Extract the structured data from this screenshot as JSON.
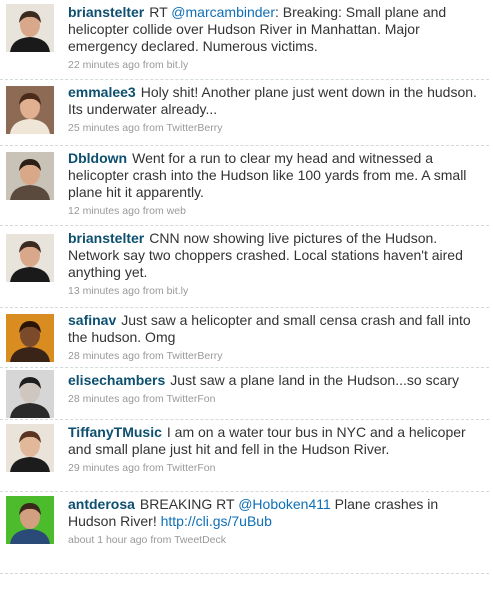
{
  "tweets": [
    {
      "user": "brianstelter",
      "parts": [
        {
          "type": "text",
          "text": "RT "
        },
        {
          "type": "mention",
          "text": "@marcambinder"
        },
        {
          "type": "text",
          "text": ": Breaking: Small plane and helicopter collide over Hudson River in Manhattan. Major emergency declared. Numerous victims."
        }
      ],
      "time": "22 minutes ago",
      "from": "from",
      "source": "bit.ly",
      "avatar": {
        "bg": "#e8e4dc",
        "skin": "#d9a88a",
        "hair": "#3b2a20",
        "shirt": "#1a1a1a"
      }
    },
    {
      "user": "emmalee3",
      "parts": [
        {
          "type": "text",
          "text": "Holy shit! Another plane just went down in the hudson. Its underwater already..."
        }
      ],
      "time": "25 minutes ago",
      "from": "from",
      "source": "TwitterBerry",
      "avatar": {
        "bg": "#8c6a54",
        "skin": "#e0b090",
        "hair": "#4a2a18",
        "shirt": "#f0e6d8"
      }
    },
    {
      "user": "Dbldown",
      "parts": [
        {
          "type": "text",
          "text": "Went for a run to clear my head and witnessed a helicopter crash into the Hudson like 100 yards from me. A small plane hit it apparently."
        }
      ],
      "time": "12 minutes ago",
      "from": "from",
      "source": "web",
      "avatar": {
        "bg": "#c9c2b6",
        "skin": "#d8a888",
        "hair": "#2a1e16",
        "shirt": "#5a4a3e"
      }
    },
    {
      "user": "brianstelter",
      "parts": [
        {
          "type": "text",
          "text": "CNN now showing live pictures of the Hudson. Network say two choppers crashed. Local stations haven't aired anything yet."
        }
      ],
      "time": "13 minutes ago",
      "from": "from",
      "source": "bit.ly",
      "avatar": {
        "bg": "#e8e4dc",
        "skin": "#d9a88a",
        "hair": "#3b2a20",
        "shirt": "#1a1a1a"
      }
    },
    {
      "user": "safinav",
      "parts": [
        {
          "type": "text",
          "text": "Just saw a helicopter and small censa crash and fall into the hudson. Omg"
        }
      ],
      "time": "28 minutes ago",
      "from": "from",
      "source": "TwitterBerry",
      "avatar": {
        "bg": "#d98c20",
        "skin": "#7a4a2a",
        "hair": "#2a1408",
        "shirt": "#3a2418"
      }
    },
    {
      "user": "elisechambers",
      "parts": [
        {
          "type": "text",
          "text": "Just saw a plane land in the Hudson...so scary"
        }
      ],
      "time": "28 minutes ago",
      "from": "from",
      "source": "TwitterFon",
      "avatar": {
        "bg": "#d6d6d6",
        "skin": "#cfc6bf",
        "hair": "#1e1e1e",
        "shirt": "#2a2a2a"
      }
    },
    {
      "user": "TiffanyTMusic",
      "parts": [
        {
          "type": "text",
          "text": "I am on a water tour bus in NYC and a helicoper and small plane just hit and fell in the Hudson River."
        }
      ],
      "time": "29 minutes ago",
      "from": "from",
      "source": "TwitterFon",
      "avatar": {
        "bg": "#e9e3da",
        "skin": "#e2b89a",
        "hair": "#5a3420",
        "shirt": "#1c1c1c"
      }
    },
    {
      "user": "antderosa",
      "parts": [
        {
          "type": "text",
          "text": "BREAKING RT "
        },
        {
          "type": "mention",
          "text": "@Hoboken411"
        },
        {
          "type": "text",
          "text": " Plane crashes in Hudson River! "
        },
        {
          "type": "link",
          "text": "http://cli.gs/7uBub"
        }
      ],
      "time": "about 1 hour ago",
      "from": "from",
      "source": "TweetDeck",
      "avatar": {
        "bg": "#4cbb2c",
        "skin": "#d2a080",
        "hair": "#3a2a1c",
        "shirt": "#2a4a78"
      }
    }
  ]
}
